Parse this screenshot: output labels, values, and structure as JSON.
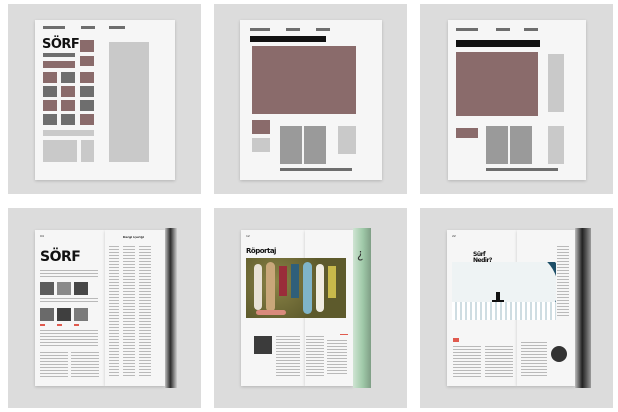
{
  "wireframes": [
    {
      "title": "SÖRF"
    },
    {},
    {}
  ],
  "mockups": [
    {
      "title": "SÖRF",
      "side_label": "Dergi içeriği"
    },
    {
      "title": "Röportaj"
    },
    {
      "title": "Sürf Nedir?"
    }
  ],
  "colors": {
    "accent_mauve": "#8a6b6b",
    "tile_bg": "#dcdcdc",
    "page_bg": "#f6f6f6",
    "accent_red": "#e05a4e"
  }
}
